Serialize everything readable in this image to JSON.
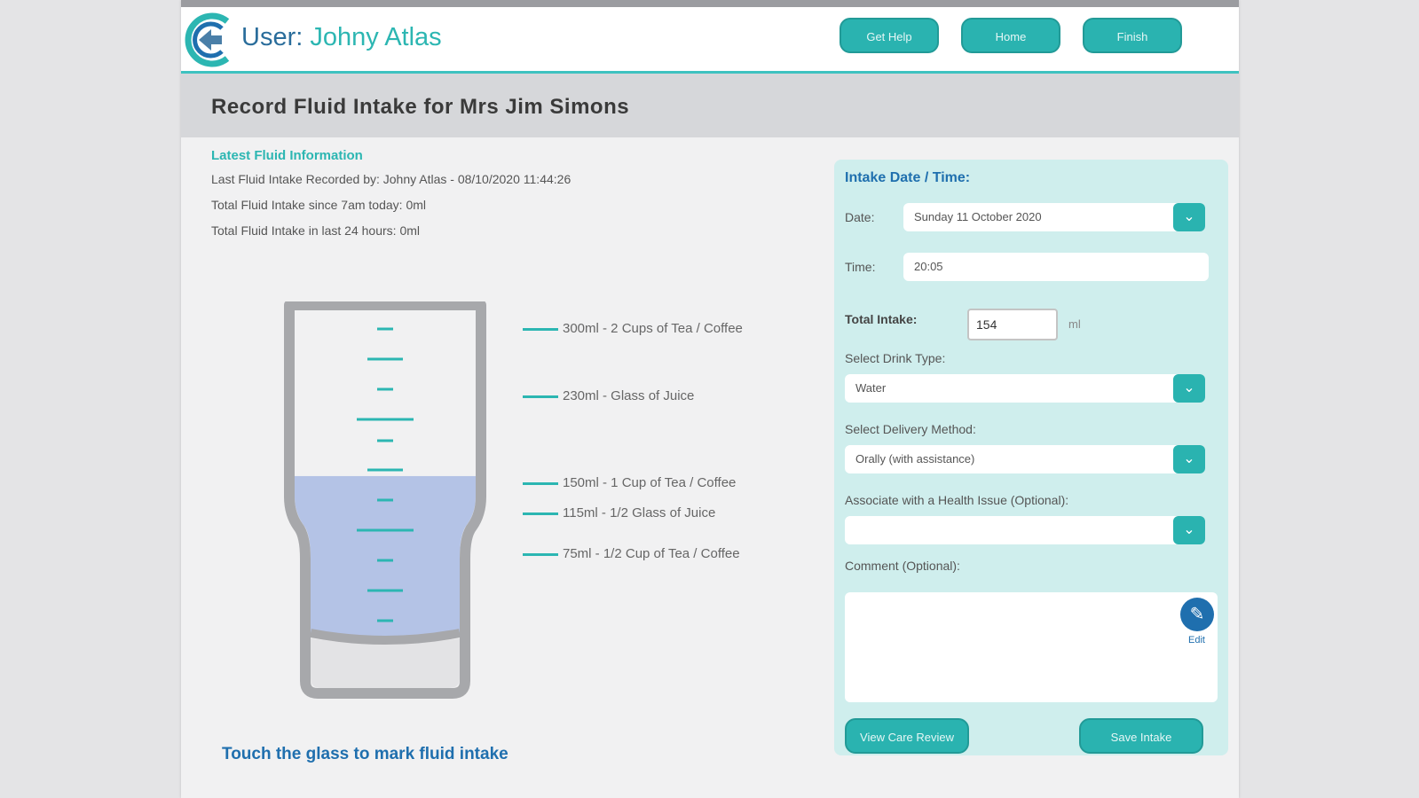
{
  "header": {
    "user_prefix": "User:",
    "user_name": "Johny Atlas",
    "buttons": [
      "Get Help",
      "Home",
      "Finish"
    ]
  },
  "page_title": "Record Fluid Intake for Mrs Jim Simons",
  "latest": {
    "title": "Latest Fluid Information",
    "last_recorded": "Last Fluid Intake Recorded by: Johny Atlas - 08/10/2020 11:44:26",
    "since_7am": "Total Fluid Intake since 7am today: 0ml",
    "last_24h": "Total Fluid Intake in last 24 hours: 0ml"
  },
  "glass": {
    "fill_ml": 154,
    "capacity_ml": 300,
    "markers": [
      {
        "ml": 300,
        "label": "300ml - 2 Cups of Tea / Coffee"
      },
      {
        "ml": 230,
        "label": "230ml - Glass of Juice"
      },
      {
        "ml": 150,
        "label": "150ml - 1 Cup of Tea / Coffee"
      },
      {
        "ml": 115,
        "label": "115ml - 1/2 Glass of Juice"
      },
      {
        "ml": 75,
        "label": "75ml - 1/2 Cup of Tea / Coffee"
      }
    ],
    "hint": "Touch the glass to mark fluid intake"
  },
  "form": {
    "title": "Intake Date / Time:",
    "date_label": "Date:",
    "date_value": "Sunday 11 October 2020",
    "time_label": "Time:",
    "time_value": "20:05",
    "total_label": "Total Intake:",
    "total_value": "154",
    "total_unit": "ml",
    "drink_label": "Select Drink Type:",
    "drink_value": "Water",
    "delivery_label": "Select Delivery Method:",
    "delivery_value": "Orally (with assistance)",
    "health_label": "Associate with a Health Issue (Optional):",
    "health_value": "",
    "comment_label": "Comment (Optional):",
    "edit_label": "Edit",
    "view_button": "View Care Review",
    "save_button": "Save Intake"
  },
  "colors": {
    "accent": "#2ab3b0",
    "title_blue": "#1f6fae",
    "liquid": "#b4c3e6"
  }
}
